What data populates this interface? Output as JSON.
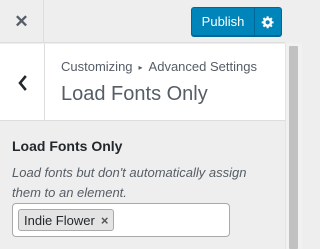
{
  "header": {
    "close_icon": "close-icon",
    "publish_label": "Publish",
    "gear_icon": "gear-icon"
  },
  "section": {
    "back_icon": "chevron-left-icon",
    "breadcrumb_parent": "Customizing",
    "breadcrumb_separator": "▸",
    "breadcrumb_child": "Advanced Settings",
    "title": "Load Fonts Only"
  },
  "control": {
    "label": "Load Fonts Only",
    "description": "Load fonts but don't automatically assign them to an element.",
    "selected_tags": [
      {
        "label": "Indie Flower",
        "remove": "×"
      }
    ]
  },
  "colors": {
    "accent": "#0085ba",
    "background": "#eeeeee"
  }
}
